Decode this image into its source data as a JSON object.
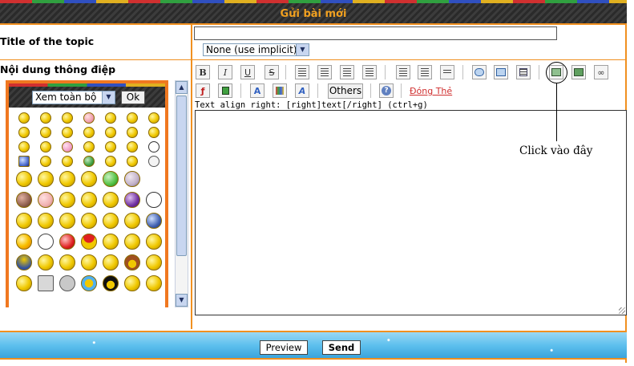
{
  "header": {
    "title": "Gửi bài mới"
  },
  "form": {
    "topic_label": "Title of the topic",
    "topic_value": "",
    "prefix_select": "None (use implicit)",
    "content_label": "Nội dung thông điệp"
  },
  "smilies_panel": {
    "view_select": "Xem toàn bộ",
    "ok_label": "Ok"
  },
  "toolbar": {
    "bold": "B",
    "italic": "I",
    "underline": "U",
    "strike": "S",
    "others_label": "Others",
    "close_tags_label": "Đóng Thẻ",
    "help_text": "Text align right: [right]text[/right] (ctrl+g)"
  },
  "annotation": {
    "text": "Click vào đây"
  },
  "footer": {
    "preview_label": "Preview",
    "send_label": "Send"
  }
}
